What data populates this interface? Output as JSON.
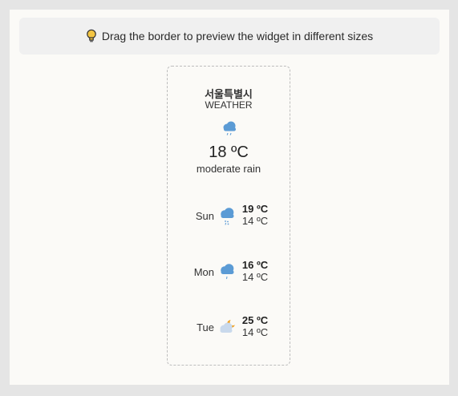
{
  "hint": {
    "icon": "lightbulb-icon",
    "text": "Drag the border to preview the widget in different sizes"
  },
  "widget": {
    "city": "서울특별시",
    "subtitle": "WEATHER",
    "current": {
      "icon": "rain-cloud-icon",
      "temp": "18 ºC",
      "description": "moderate rain"
    },
    "forecast": [
      {
        "day": "Sun",
        "icon": "snow-rain-cloud-icon",
        "high": "19 ºC",
        "low": "14 ºC"
      },
      {
        "day": "Mon",
        "icon": "rain-cloud-icon",
        "high": "16 ºC",
        "low": "14 ºC"
      },
      {
        "day": "Tue",
        "icon": "partly-cloudy-night-icon",
        "high": "25 ºC",
        "low": "14 ºC"
      }
    ]
  },
  "colors": {
    "cloud_blue": "#5b9bd5",
    "cloud_light": "#c9d9ec",
    "moon_orange": "#f0a020"
  }
}
